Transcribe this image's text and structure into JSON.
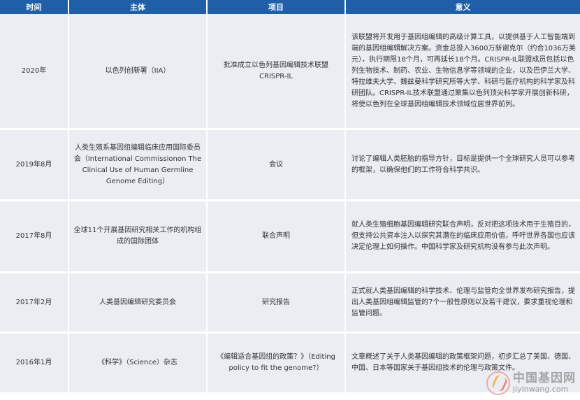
{
  "headers": {
    "time": "时间",
    "subject": "主体",
    "project": "项目",
    "meaning": "意义"
  },
  "rows": [
    {
      "time": "2020年",
      "subject": "以色列创新署（IIA）",
      "project": "批准成立以色列基因编辑技术联盟CRISPR-IL",
      "meaning": "该联盟将开发用于基因组编辑的高级计算工具，以提供基于人工智能端到端的基因组编辑解决方案。资金总投入3600万新谢克尔（约合1036万美元），执行期限18个月，可再延长18个月。CRISPR-IL联盟成员包括以色列生物技术、制药、农业、生物信息学等领域的企业，以及巴伊兰大学、特拉维夫大学、魏兹曼科学研究所等大学、科研与医疗机构的科学家及科研团队。CRISPR-IL技术联盟通过聚集以色列顶尖科学家开展创新科研，将使以色列在全球基因组编辑技术领域位居世界前列。"
    },
    {
      "time": "2019年8月",
      "subject": "人类生殖系基因组编辑临床应用国际委员会（International Commissionon The Clinical Use of Human Germline Genome Editing）",
      "project": "会议",
      "meaning": "讨论了编辑人类胚胎的指导方针，目标是提供一个全球研究人员可以参考的框架，以确保他们的工作符合科学共识。"
    },
    {
      "time": "2017年8月",
      "subject": "全球11个开展基因研究相关工作的机构组成的国际团体",
      "project": "联合声明",
      "meaning": "就人类生殖细胞基因编辑研究联合声明，反对把这项技术用于生殖目的，但支持公共资本注入以探究其潜在的临床应用价值，呼吁世界各国也应该决定伦理上如何操作。中国科学家及研究机构没有参与此次声明。"
    },
    {
      "time": "2017年2月",
      "subject": "人类基因编辑研究委员会",
      "project": "研究报告",
      "meaning": "正式就人类基因编辑的科学技术、伦理与监管向全世界发布研究报告，提出人类基因组编辑监管的7个一般性原则以及若干建议，要求重视伦理和监管问题。"
    },
    {
      "time": "2016年1月",
      "subject": "《科学》（Science）杂志",
      "project": "《编辑适合基因组的政策？》（Editing policy to fit the genome?）",
      "meaning": "文章概述了关于人类基因编辑的政策框架问题，初步汇总了美国、德国、中国、日本等国家关于基因组技术的伦理与政策文件。"
    }
  ],
  "watermark": {
    "name": "中国基因网",
    "url": "jiyinwang.com"
  }
}
